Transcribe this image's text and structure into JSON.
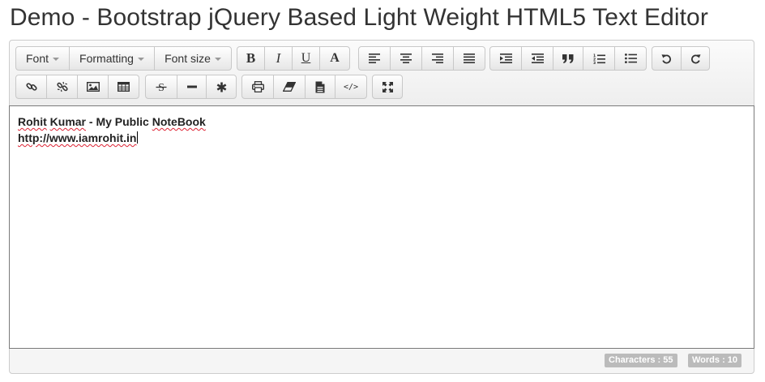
{
  "page": {
    "title": "Demo - Bootstrap jQuery Based Light Weight HTML5 Text Editor"
  },
  "toolbar": {
    "dropdowns": {
      "font": "Font",
      "formatting": "Formatting",
      "font_size": "Font size"
    },
    "glyphs": {
      "bold": "B",
      "italic": "I",
      "underline": "U",
      "font_color": "A",
      "source_code": "</>"
    },
    "row1_icons": [
      "bold-icon",
      "italic-icon",
      "underline-icon",
      "font-color-icon",
      "align-left-icon",
      "align-center-icon",
      "align-right-icon",
      "align-justify-icon",
      "indent-icon",
      "outdent-icon",
      "blockquote-icon",
      "ordered-list-icon",
      "unordered-list-icon",
      "undo-icon",
      "redo-icon"
    ],
    "row2_icons": [
      "link-icon",
      "unlink-icon",
      "image-icon",
      "table-icon",
      "strikethrough-icon",
      "horizontal-rule-icon",
      "special-char-icon",
      "print-icon",
      "eraser-icon",
      "document-icon",
      "code-icon",
      "fullscreen-icon"
    ]
  },
  "content": {
    "line1_parts": [
      "Rohit",
      " ",
      "Kumar",
      " - My Public ",
      "NoteBook"
    ],
    "line2": "http://www.iamrohit.in"
  },
  "status": {
    "characters": "Characters : 55",
    "words": "Words : 10"
  },
  "colors": {
    "toolbar_bg": "#f0f0f0",
    "badge_bg": "#bbbbbb",
    "spellcheck_underline": "#dd2233"
  }
}
